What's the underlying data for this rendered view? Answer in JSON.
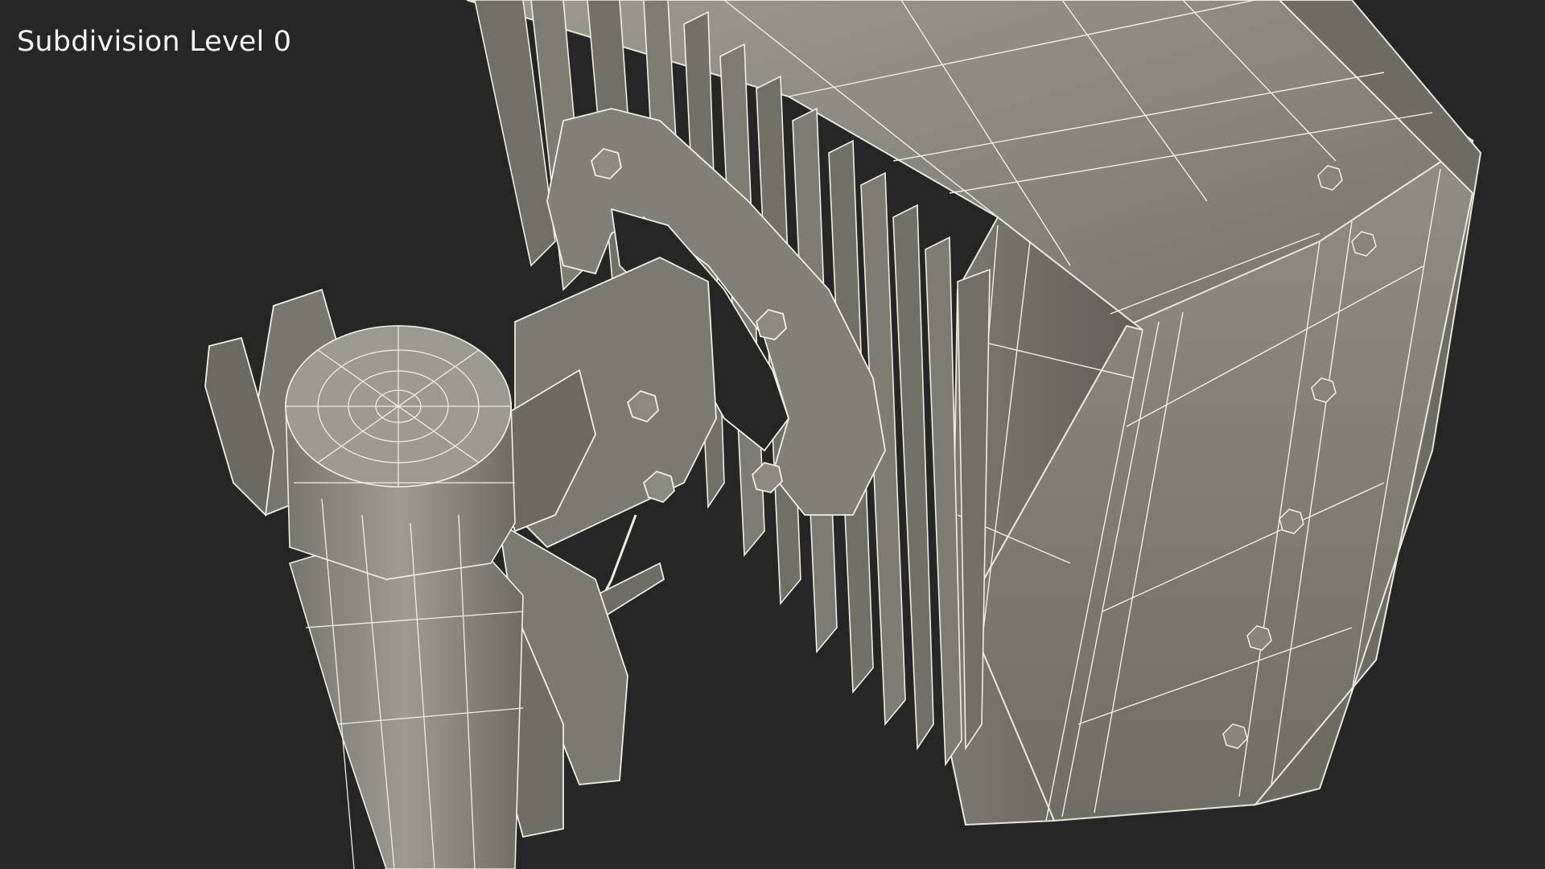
{
  "viewport": {
    "overlay_label": "Subdivision Level 0",
    "background_color": "#262626",
    "model_face_color": "#8a8a7e",
    "wire_color": "#ecece0"
  }
}
